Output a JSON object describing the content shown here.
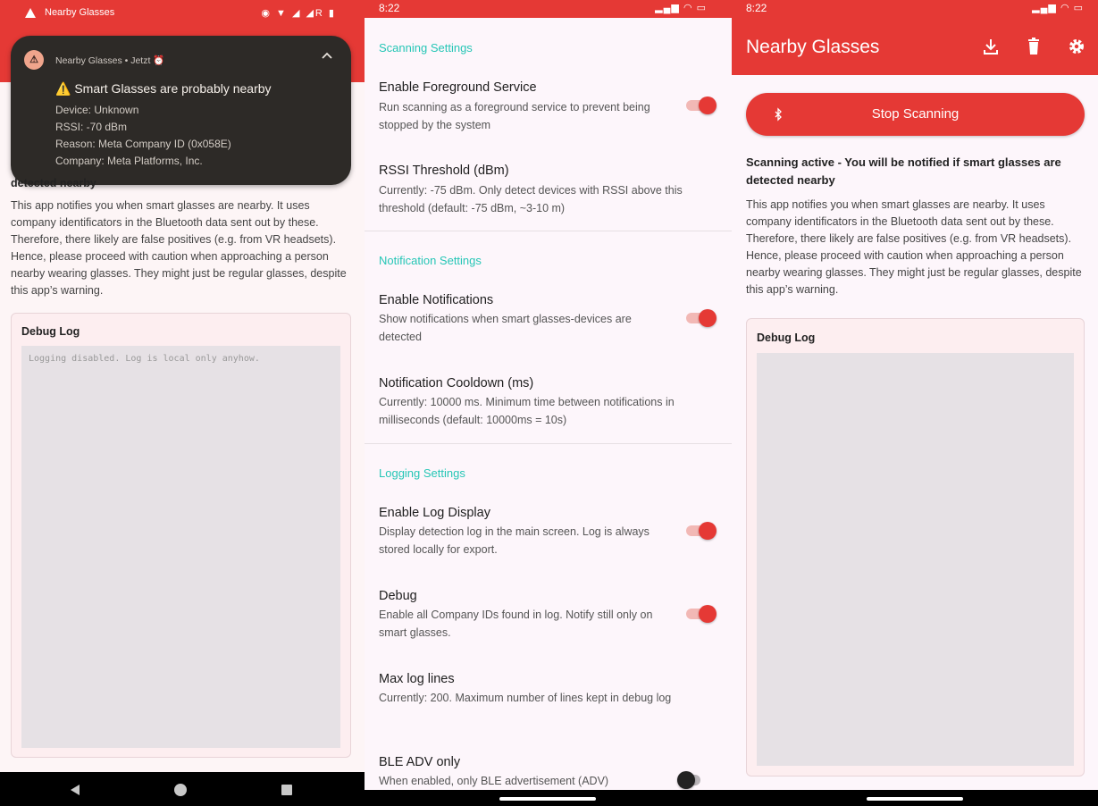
{
  "colors": {
    "primary": "#e53935",
    "accent": "#26c6b6",
    "surface": "#fdf6fb"
  },
  "panel1": {
    "status_title": "Nearby Glasses",
    "notification": {
      "app": "Nearby Glasses",
      "when": "Jetzt",
      "heading": "⚠️ Smart Glasses are probably nearby",
      "device": "Device: Unknown",
      "rssi": "RSSI: -70 dBm",
      "reason": "Reason: Meta Company ID (0x058E)",
      "company": "Company: Meta Platforms, Inc."
    },
    "partial_text": "detected nearby",
    "description": "This app notifies you when smart glasses are nearby. It uses company identificators in the Bluetooth data sent out by these. Therefore, there likely are false positives (e.g. from VR headsets). Hence, please proceed with caution when approaching a person nearby wearing glasses. They might just be regular glasses, despite this app’s warning.",
    "debug_log_label": "Debug Log",
    "log_placeholder": "Logging disabled. Log is local only anyhow."
  },
  "panel2": {
    "time": "8:22",
    "sections": [
      {
        "label": "Scanning Settings"
      },
      {
        "label": "Notification Settings"
      },
      {
        "label": "Logging Settings"
      }
    ],
    "settings": [
      {
        "title": "Enable Foreground Service",
        "subtitle": "Run scanning as a foreground service to prevent being stopped by the system"
      },
      {
        "title": "RSSI Threshold (dBm)",
        "subtitle": "Currently: -75 dBm. Only detect devices with RSSI above this threshold (default: -75 dBm, ~3-10 m)"
      },
      {
        "title": "Enable Notifications",
        "subtitle": "Show notifications when smart glasses-devices are detected"
      },
      {
        "title": "Notification Cooldown (ms)",
        "subtitle": "Currently: 10000 ms. Minimum time between notifications in milliseconds (default: 10000ms = 10s)"
      },
      {
        "title": "Enable Log Display",
        "subtitle": "Display detection log in the main screen. Log is always stored locally for export."
      },
      {
        "title": "Debug",
        "subtitle": "Enable all Company IDs found in log. Notify still only on smart glasses."
      },
      {
        "title": "Max log lines",
        "subtitle": "Currently: 200. Maximum number of lines kept in debug log"
      },
      {
        "title": "BLE ADV only",
        "subtitle": "When enabled, only BLE advertisement (ADV)"
      }
    ]
  },
  "panel3": {
    "time": "8:22",
    "app_title": "Nearby Glasses",
    "stop_button": "Stop Scanning",
    "active_status": "Scanning active - You will be notified if smart glasses are detected nearby",
    "description": "This app notifies you when smart glasses are nearby. It uses company identificators in the Bluetooth data sent out by these. Therefore, there likely are false positives (e.g. from VR headsets). Hence, please proceed with caution when approaching a person nearby wearing glasses. They might just be regular glasses, despite this app’s warning.",
    "debug_log_label": "Debug Log"
  }
}
